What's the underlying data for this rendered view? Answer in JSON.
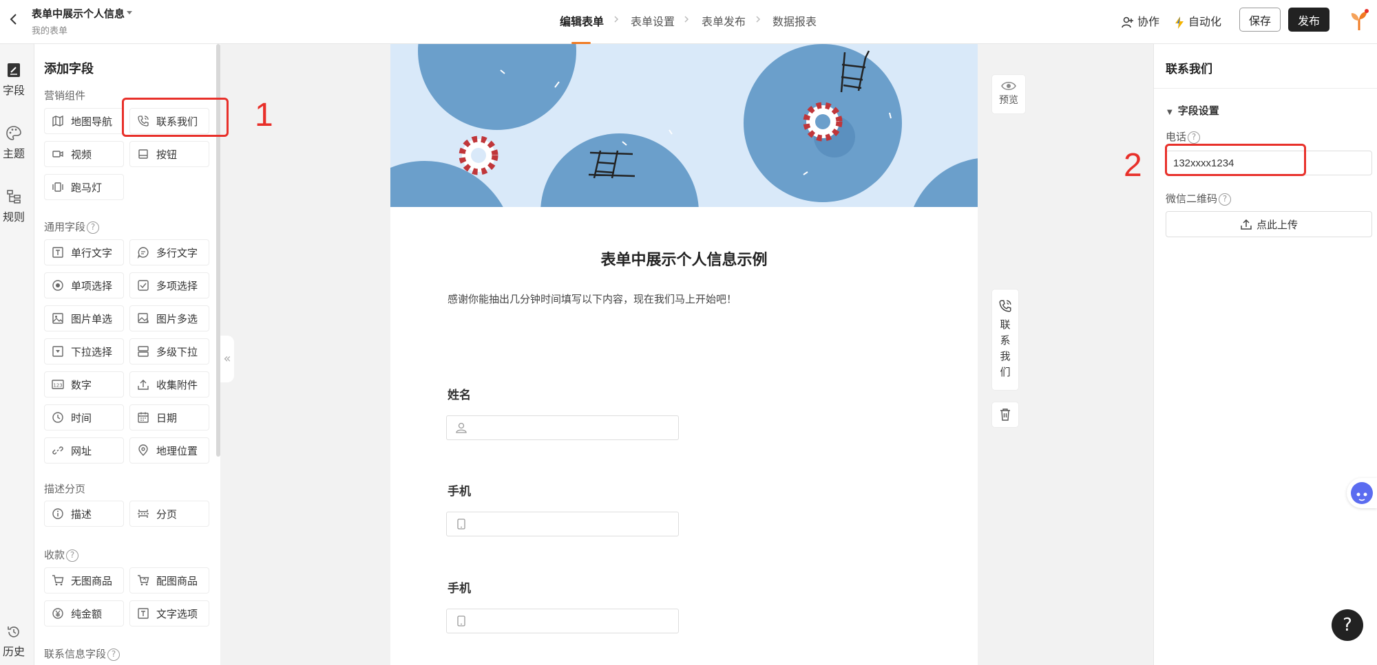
{
  "header": {
    "title": "表单中展示个人信息",
    "subtitle": "我的表单",
    "steps": [
      "编辑表单",
      "表单设置",
      "表单发布",
      "数据报表"
    ],
    "collaborate": "协作",
    "automation": "自动化",
    "save": "保存",
    "publish": "发布",
    "accent_color": "#f07a22"
  },
  "leftnav": {
    "items": [
      "字段",
      "主题",
      "规则"
    ],
    "history": "历史"
  },
  "fieldpanel": {
    "title": "添加字段",
    "sections": {
      "marketing": {
        "title": "营销组件",
        "items": [
          "地图导航",
          "联系我们",
          "视频",
          "按钮",
          "跑马灯"
        ]
      },
      "general": {
        "title": "通用字段",
        "items": [
          "单行文字",
          "多行文字",
          "单项选择",
          "多项选择",
          "图片单选",
          "图片多选",
          "下拉选择",
          "多级下拉",
          "数字",
          "收集附件",
          "时间",
          "日期",
          "网址",
          "地理位置"
        ]
      },
      "desc": {
        "title": "描述分页",
        "items": [
          "描述",
          "分页"
        ]
      },
      "payment": {
        "title": "收款",
        "items": [
          "无图商品",
          "配图商品",
          "纯金额",
          "文字选项"
        ]
      },
      "contact": {
        "title": "联系信息字段"
      }
    }
  },
  "form": {
    "heading": "表单中展示个人信息示例",
    "description": "感谢你能抽出几分钟时间填写以下内容，现在我们马上开始吧！",
    "questions": [
      "姓名",
      "手机",
      "手机"
    ]
  },
  "tools": {
    "preview": "预览",
    "contact": "联系我们"
  },
  "props": {
    "title": "联系我们",
    "section": "字段设置",
    "phone_label": "电话",
    "phone_value": "132xxxx1234",
    "wechat_label": "微信二维码",
    "upload": "点此上传"
  },
  "annotations": [
    "1",
    "2"
  ],
  "help": "?"
}
